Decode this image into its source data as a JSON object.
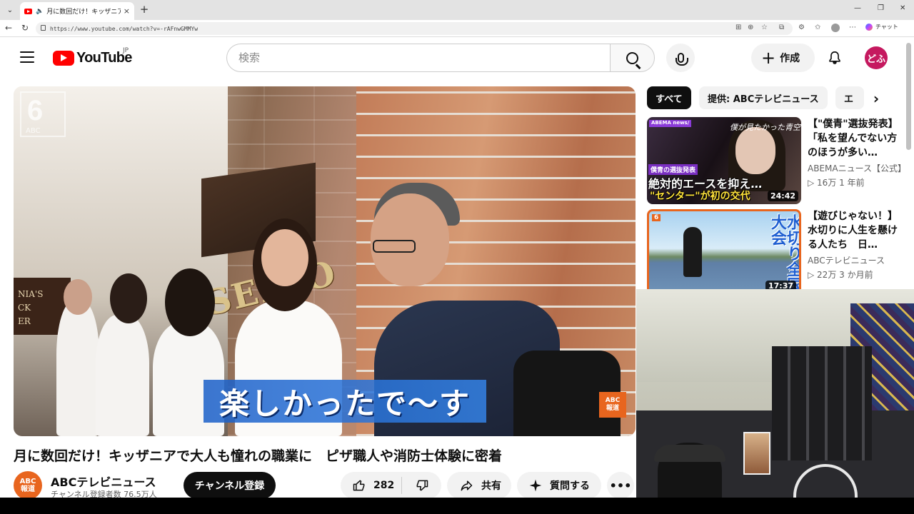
{
  "browser": {
    "tab_title": "月に数回だけ！キッザニアで大人も憧れの職業に",
    "tab_close": "×",
    "new_tab": "+",
    "url": "https://www.youtube.com/watch?v=-rAFnwGMMYw",
    "copilot_label": "チャット",
    "window_controls": [
      "—",
      "❐",
      "✕"
    ]
  },
  "masthead": {
    "logo_text": "YouTube",
    "region": "JP",
    "search_placeholder": "検索",
    "create_label": "作成",
    "avatar_text": "どふ"
  },
  "player": {
    "caption": "楽しかったで〜す",
    "watermark": "6",
    "watermark_sub": "ABC",
    "sign_text": "NIA'S\nCK\nER",
    "brand_on_wall": "SEIKO",
    "badge_top": "ABC",
    "badge_bottom": "報道"
  },
  "video": {
    "title": "月に数回だけ！キッザニアで大人も憧れの職業に　ピザ職人や消防士体験に密着",
    "channel_name": "ABCテレビニュース",
    "channel_subs": "チャンネル登録者数 76.5万人",
    "channel_avatar_top": "ABC",
    "channel_avatar_bottom": "報道",
    "subscribe_label": "チャンネル登録",
    "like_count": "282",
    "share_label": "共有",
    "ask_label": "質問する",
    "more_label": "•••"
  },
  "sidebar": {
    "chips": [
      "すべて",
      "提供: ABCテレビニュース",
      "エ"
    ],
    "recommendations": [
      {
        "title": "【\"僕青\"選抜発表】「私を望んでない方のほうが多い…",
        "channel": "ABEMAニュース【公式】",
        "meta": "▷ 16万  1 年前",
        "duration": "24:42",
        "thumb_brand": "ABEMA news/",
        "thumb_script": "僕が見たかった青空",
        "thumb_kicker": "僕青の選抜発表",
        "thumb_line1": "絶対的エースを抑え…",
        "thumb_line2": "\"センター\"が初の交代"
      },
      {
        "title": "【遊びじゃない！】水切りに人生を懸ける人たち　日…",
        "channel": "ABCテレビニュース",
        "meta": "▷ 22万  3 か月前",
        "duration": "17:37",
        "thumb_badge": "6",
        "thumb_text": "水切り全国大会"
      }
    ]
  }
}
